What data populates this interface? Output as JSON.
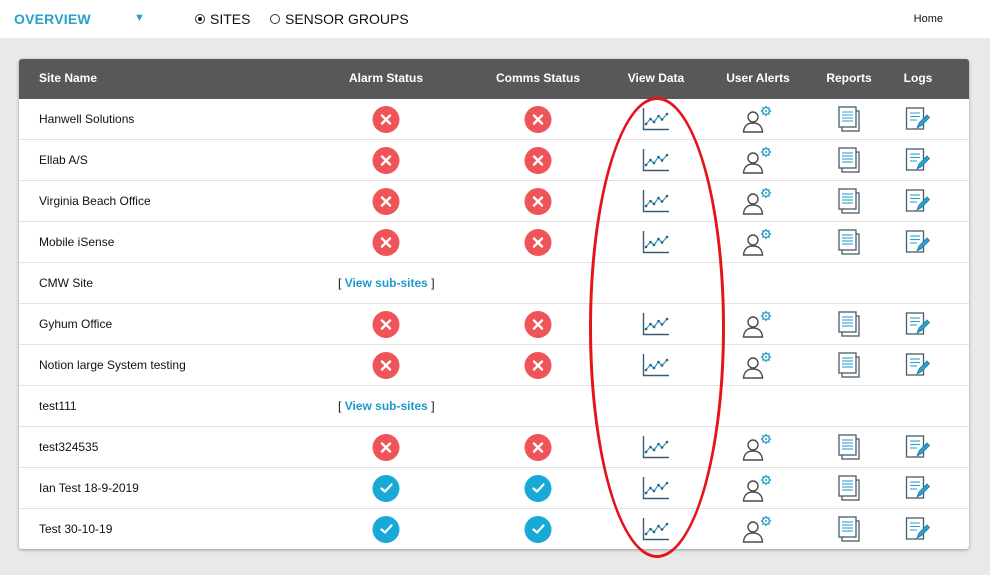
{
  "nav": {
    "overview_label": "OVERVIEW",
    "caret": "▼",
    "sites_label": "SITES",
    "sensor_groups_label": "SENSOR GROUPS",
    "home_label": "Home"
  },
  "table": {
    "headers": {
      "site_name": "Site Name",
      "alarm_status": "Alarm Status",
      "comms_status": "Comms Status",
      "view_data": "View Data",
      "user_alerts": "User Alerts",
      "reports": "Reports",
      "logs": "Logs"
    },
    "view_subsites_label": "View sub-sites",
    "bracket_open": "[",
    "bracket_close": "]",
    "rows": [
      {
        "name": "Hanwell Solutions",
        "alarm": "error",
        "comms": "error"
      },
      {
        "name": "Ellab A/S",
        "alarm": "error",
        "comms": "error"
      },
      {
        "name": "Virginia Beach Office",
        "alarm": "error",
        "comms": "error"
      },
      {
        "name": "Mobile iSense",
        "alarm": "error",
        "comms": "error"
      },
      {
        "name": "CMW Site",
        "subsites": true
      },
      {
        "name": "Gyhum Office",
        "alarm": "error",
        "comms": "error"
      },
      {
        "name": "Notion large System testing",
        "alarm": "error",
        "comms": "error"
      },
      {
        "name": "test111",
        "subsites": true
      },
      {
        "name": "test324535",
        "alarm": "error",
        "comms": "error"
      },
      {
        "name": "Ian Test 18-9-2019",
        "alarm": "ok",
        "comms": "ok"
      },
      {
        "name": "Test 30-10-19",
        "alarm": "ok",
        "comms": "ok"
      }
    ]
  },
  "colors": {
    "accent": "#2aa1cc",
    "header_bg": "#58585a",
    "error": "#ef5458",
    "ok": "#19a9d6",
    "highlight": "#e5141b"
  }
}
